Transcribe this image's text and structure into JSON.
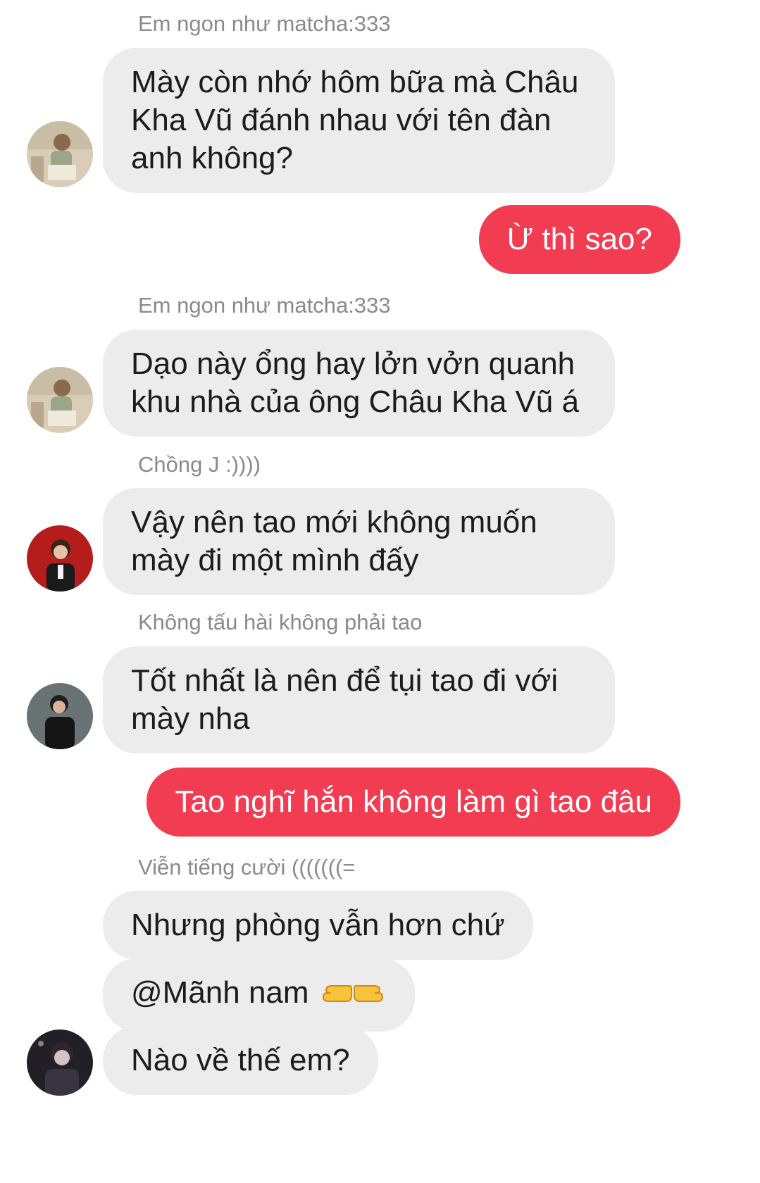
{
  "messages": [
    {
      "sender": "Em ngon như matcha:333",
      "text": "Mày còn nhớ hôm bữa mà Châu Kha Vũ đánh nhau với tên đàn anh không?"
    },
    {
      "outgoing": true,
      "text": "Ừ thì sao?"
    },
    {
      "sender": "Em ngon như matcha:333",
      "text": "Dạo này ổng hay lởn vởn quanh khu nhà của ông Châu Kha Vũ á"
    },
    {
      "sender": "Chồng J :))))",
      "text": "Vậy nên tao mới không muốn mày đi một mình đấy"
    },
    {
      "sender": "Không tấu hài không phải tao",
      "text": "Tốt nhất là nên để tụi tao đi với mày nha"
    },
    {
      "outgoing": true,
      "text": "Tao nghĩ hắn không làm gì tao đâu"
    },
    {
      "sender": "Viễn tiếng cười (((((((=",
      "texts": [
        "Nhưng phòng vẫn hơn chứ",
        "@Mãnh nam",
        "Nào về thế em?"
      ]
    }
  ],
  "mention_emoji": "pointing-hands-emoji",
  "colors": {
    "outgoing_bubble": "#f23c52",
    "incoming_bubble": "#ececec",
    "sender_name": "#8a8a8a"
  }
}
